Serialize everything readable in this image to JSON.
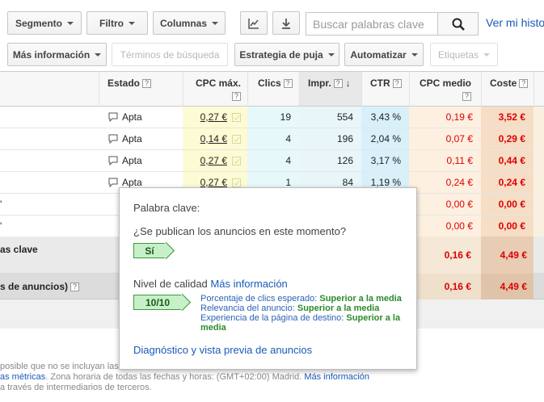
{
  "toolbar": {
    "segmento": "Segmento",
    "filtro": "Filtro",
    "columnas": "Columnas",
    "search_placeholder": "Buscar palabras clave",
    "history_link": "Ver mi histo",
    "mas_info": "Más información",
    "terminos": "Términos de búsqueda",
    "estrategia": "Estrategia de puja",
    "automatizar": "Automatizar",
    "etiquetas": "Etiquetas"
  },
  "table": {
    "headers": {
      "estado": "Estado",
      "cpc_max": "CPC máx.",
      "clics": "Clics",
      "impr": "Impr.",
      "ctr": "CTR",
      "cpc_medio": "CPC medio",
      "coste": "Coste"
    },
    "rows": [
      {
        "left": "",
        "estado": "Apta",
        "cpc_max": "0,27 €",
        "clics": "19",
        "impr": "554",
        "ctr": "3,43 %",
        "cpc_medio": "0,19 €",
        "coste": "3,52 €"
      },
      {
        "left": "",
        "estado": "Apta",
        "cpc_max": "0,14 €",
        "clics": "4",
        "impr": "196",
        "ctr": "2,04 %",
        "cpc_medio": "0,07 €",
        "coste": "0,29 €"
      },
      {
        "left": "",
        "estado": "Apta",
        "cpc_max": "0,27 €",
        "clics": "4",
        "impr": "126",
        "ctr": "3,17 %",
        "cpc_medio": "0,11 €",
        "coste": "0,44 €"
      },
      {
        "left": "",
        "estado": "Apta",
        "cpc_max": "0,27 €",
        "clics": "1",
        "impr": "84",
        "ctr": "1,19 %",
        "cpc_medio": "0,24 €",
        "coste": "0,24 €"
      },
      {
        "left": "'",
        "estado": "",
        "cpc_max": "",
        "clics": "",
        "impr": "",
        "ctr": "",
        "cpc_medio": "0,00 €",
        "coste": "0,00 €"
      },
      {
        "left": "'",
        "estado": "",
        "cpc_max": "",
        "clics": "",
        "impr": "",
        "ctr": "",
        "cpc_medio": "0,00 €",
        "coste": "0,00 €"
      }
    ],
    "total1": {
      "label": "as clave",
      "cpc_medio": "0,16 €",
      "coste": "4,49 €"
    },
    "total2": {
      "label": "s de anuncios)",
      "cpc_medio": "0,16 €",
      "coste": "4,49 €"
    }
  },
  "popup": {
    "keyword_label": "Palabra clave:",
    "question": "¿Se publican los anuncios en este momento?",
    "answer": "Sí",
    "quality_label": "Nivel de calidad",
    "quality_link": "Más información",
    "score": "10/10",
    "l1": "Porcentaje de clics esperado:",
    "v1": "Superior a la media",
    "l2": "Relevancia del anuncio:",
    "v2": "Superior a la media",
    "l3": "Experiencia de la página de destino:",
    "v3a": "Superior a la",
    "v3b": "media",
    "diag_link": "Diagnóstico y vista previa de anuncios"
  },
  "footer": {
    "line1": "posible que no se incluyan las",
    "line2_link": "as métricas",
    "line2_text": ". Zona horaria de todas las fechas y horas: (GMT+02:00) Madrid.",
    "line2_link2": "Más información",
    "line3": "a través de intermediarios de terceros."
  }
}
